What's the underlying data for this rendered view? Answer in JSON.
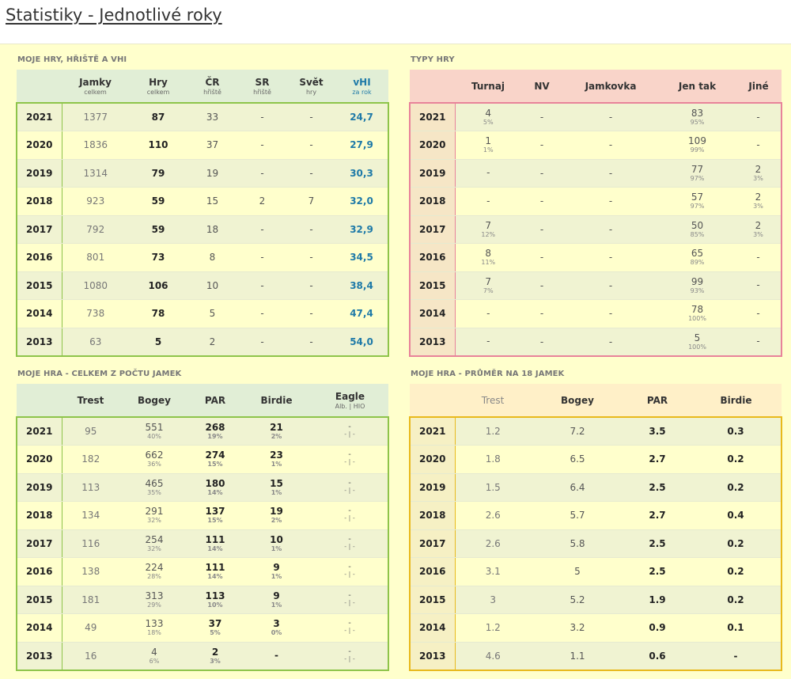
{
  "page": {
    "title": "Statistiky - Jednotlivé roky"
  },
  "games": {
    "title": "MOJE HRY, HŘIŠTĚ A vHI",
    "headers": [
      {
        "main": "Jamky",
        "sub": "celkem"
      },
      {
        "main": "Hry",
        "sub": "celkem"
      },
      {
        "main": "ČR",
        "sub": "hřiště"
      },
      {
        "main": "SR",
        "sub": "hřiště"
      },
      {
        "main": "Svět",
        "sub": "hry"
      },
      {
        "main": "vHI",
        "sub": "za rok"
      }
    ],
    "rows": [
      {
        "year": "2021",
        "holes": "1377",
        "games": "87",
        "cr": "33",
        "sr": "-",
        "world": "-",
        "vhi": "24,7"
      },
      {
        "year": "2020",
        "holes": "1836",
        "games": "110",
        "cr": "37",
        "sr": "-",
        "world": "-",
        "vhi": "27,9"
      },
      {
        "year": "2019",
        "holes": "1314",
        "games": "79",
        "cr": "19",
        "sr": "-",
        "world": "-",
        "vhi": "30,3"
      },
      {
        "year": "2018",
        "holes": "923",
        "games": "59",
        "cr": "15",
        "sr": "2",
        "world": "7",
        "vhi": "32,0"
      },
      {
        "year": "2017",
        "holes": "792",
        "games": "59",
        "cr": "18",
        "sr": "-",
        "world": "-",
        "vhi": "32,9"
      },
      {
        "year": "2016",
        "holes": "801",
        "games": "73",
        "cr": "8",
        "sr": "-",
        "world": "-",
        "vhi": "34,5"
      },
      {
        "year": "2015",
        "holes": "1080",
        "games": "106",
        "cr": "10",
        "sr": "-",
        "world": "-",
        "vhi": "38,4"
      },
      {
        "year": "2014",
        "holes": "738",
        "games": "78",
        "cr": "5",
        "sr": "-",
        "world": "-",
        "vhi": "47,4"
      },
      {
        "year": "2013",
        "holes": "63",
        "games": "5",
        "cr": "2",
        "sr": "-",
        "world": "-",
        "vhi": "54,0"
      }
    ]
  },
  "types": {
    "title": "TYPY HRY",
    "headers": [
      "Turnaj",
      "NV",
      "Jamkovka",
      "Jen tak",
      "Jiné"
    ],
    "rows": [
      {
        "year": "2021",
        "turnaj": "4",
        "turnaj_pct": "5%",
        "nv": "-",
        "jamkovka": "-",
        "jentak": "83",
        "jentak_pct": "95%",
        "jine": "-",
        "jine_pct": ""
      },
      {
        "year": "2020",
        "turnaj": "1",
        "turnaj_pct": "1%",
        "nv": "-",
        "jamkovka": "-",
        "jentak": "109",
        "jentak_pct": "99%",
        "jine": "-",
        "jine_pct": ""
      },
      {
        "year": "2019",
        "turnaj": "-",
        "turnaj_pct": "",
        "nv": "-",
        "jamkovka": "-",
        "jentak": "77",
        "jentak_pct": "97%",
        "jine": "2",
        "jine_pct": "3%"
      },
      {
        "year": "2018",
        "turnaj": "-",
        "turnaj_pct": "",
        "nv": "-",
        "jamkovka": "-",
        "jentak": "57",
        "jentak_pct": "97%",
        "jine": "2",
        "jine_pct": "3%"
      },
      {
        "year": "2017",
        "turnaj": "7",
        "turnaj_pct": "12%",
        "nv": "-",
        "jamkovka": "-",
        "jentak": "50",
        "jentak_pct": "85%",
        "jine": "2",
        "jine_pct": "3%"
      },
      {
        "year": "2016",
        "turnaj": "8",
        "turnaj_pct": "11%",
        "nv": "-",
        "jamkovka": "-",
        "jentak": "65",
        "jentak_pct": "89%",
        "jine": "-",
        "jine_pct": ""
      },
      {
        "year": "2015",
        "turnaj": "7",
        "turnaj_pct": "7%",
        "nv": "-",
        "jamkovka": "-",
        "jentak": "99",
        "jentak_pct": "93%",
        "jine": "-",
        "jine_pct": ""
      },
      {
        "year": "2014",
        "turnaj": "-",
        "turnaj_pct": "",
        "nv": "-",
        "jamkovka": "-",
        "jentak": "78",
        "jentak_pct": "100%",
        "jine": "-",
        "jine_pct": ""
      },
      {
        "year": "2013",
        "turnaj": "-",
        "turnaj_pct": "",
        "nv": "-",
        "jamkovka": "-",
        "jentak": "5",
        "jentak_pct": "100%",
        "jine": "-",
        "jine_pct": ""
      }
    ]
  },
  "total": {
    "title": "MOJE HRA - CELKEM Z POČTU JAMEK",
    "headers": [
      "Trest",
      "Bogey",
      "PAR",
      "Birdie"
    ],
    "eagle_header": {
      "main": "Eagle",
      "sub": "Alb. | HIO"
    },
    "rows": [
      {
        "year": "2021",
        "trest": "95",
        "bogey": "551",
        "bogey_pct": "40%",
        "par": "268",
        "par_pct": "19%",
        "birdie": "21",
        "birdie_pct": "2%",
        "eagle": "-",
        "eagle_sub": "- | -"
      },
      {
        "year": "2020",
        "trest": "182",
        "bogey": "662",
        "bogey_pct": "36%",
        "par": "274",
        "par_pct": "15%",
        "birdie": "23",
        "birdie_pct": "1%",
        "eagle": "-",
        "eagle_sub": "- | -"
      },
      {
        "year": "2019",
        "trest": "113",
        "bogey": "465",
        "bogey_pct": "35%",
        "par": "180",
        "par_pct": "14%",
        "birdie": "15",
        "birdie_pct": "1%",
        "eagle": "-",
        "eagle_sub": "- | -"
      },
      {
        "year": "2018",
        "trest": "134",
        "bogey": "291",
        "bogey_pct": "32%",
        "par": "137",
        "par_pct": "15%",
        "birdie": "19",
        "birdie_pct": "2%",
        "eagle": "-",
        "eagle_sub": "- | -"
      },
      {
        "year": "2017",
        "trest": "116",
        "bogey": "254",
        "bogey_pct": "32%",
        "par": "111",
        "par_pct": "14%",
        "birdie": "10",
        "birdie_pct": "1%",
        "eagle": "-",
        "eagle_sub": "- | -"
      },
      {
        "year": "2016",
        "trest": "138",
        "bogey": "224",
        "bogey_pct": "28%",
        "par": "111",
        "par_pct": "14%",
        "birdie": "9",
        "birdie_pct": "1%",
        "eagle": "-",
        "eagle_sub": "- | -"
      },
      {
        "year": "2015",
        "trest": "181",
        "bogey": "313",
        "bogey_pct": "29%",
        "par": "113",
        "par_pct": "10%",
        "birdie": "9",
        "birdie_pct": "1%",
        "eagle": "-",
        "eagle_sub": "- | -"
      },
      {
        "year": "2014",
        "trest": "49",
        "bogey": "133",
        "bogey_pct": "18%",
        "par": "37",
        "par_pct": "5%",
        "birdie": "3",
        "birdie_pct": "0%",
        "eagle": "-",
        "eagle_sub": "- | -"
      },
      {
        "year": "2013",
        "trest": "16",
        "bogey": "4",
        "bogey_pct": "6%",
        "par": "2",
        "par_pct": "3%",
        "birdie": "-",
        "birdie_pct": "",
        "eagle": "-",
        "eagle_sub": "- | -"
      }
    ]
  },
  "average": {
    "title": "MOJE HRA - PRŮMĚR NA 18 JAMEK",
    "headers": [
      "Trest",
      "Bogey",
      "PAR",
      "Birdie"
    ],
    "rows": [
      {
        "year": "2021",
        "trest": "1.2",
        "bogey": "7.2",
        "par": "3.5",
        "birdie": "0.3"
      },
      {
        "year": "2020",
        "trest": "1.8",
        "bogey": "6.5",
        "par": "2.7",
        "birdie": "0.2"
      },
      {
        "year": "2019",
        "trest": "1.5",
        "bogey": "6.4",
        "par": "2.5",
        "birdie": "0.2"
      },
      {
        "year": "2018",
        "trest": "2.6",
        "bogey": "5.7",
        "par": "2.7",
        "birdie": "0.4"
      },
      {
        "year": "2017",
        "trest": "2.6",
        "bogey": "5.8",
        "par": "2.5",
        "birdie": "0.2"
      },
      {
        "year": "2016",
        "trest": "3.1",
        "bogey": "5",
        "par": "2.5",
        "birdie": "0.2"
      },
      {
        "year": "2015",
        "trest": "3",
        "bogey": "5.2",
        "par": "1.9",
        "birdie": "0.2"
      },
      {
        "year": "2014",
        "trest": "1.2",
        "bogey": "3.2",
        "par": "0.9",
        "birdie": "0.1"
      },
      {
        "year": "2013",
        "trest": "4.6",
        "bogey": "1.1",
        "par": "0.6",
        "birdie": "-"
      }
    ]
  },
  "colors": {
    "green_accent": "#8ec44a",
    "pink_accent": "#e8839a",
    "yellow_accent": "#e8b91c",
    "vhi_blue": "#1f7aa8",
    "background": "#ffffcc"
  }
}
